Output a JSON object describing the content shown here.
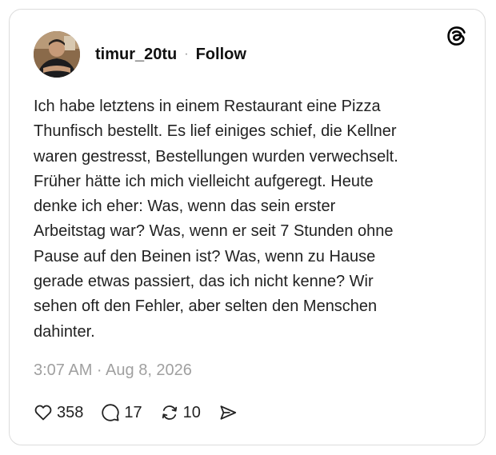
{
  "post": {
    "username": "timur_20tu",
    "separator": "·",
    "follow_label": "Follow",
    "avatar_icon": "profile-photo",
    "brand_icon": "threads-logo-icon",
    "text": "Ich habe letztens in einem Restaurant eine Pizza\nThunfisch bestellt. Es lief einiges schief, die Kellner\nwaren gestresst, Bestellungen wurden verwechselt.\nFrüher hätte ich mich vielleicht aufgeregt. Heute\ndenke ich eher: Was, wenn das sein erster\nArbeitstag war? Was, wenn er seit 7 Stunden ohne\nPause auf den Beinen ist? Was, wenn zu Hause\ngerade etwas passiert, das ich nicht kenne? Wir\nsehen oft den Fehler, aber selten den Menschen\ndahinter.",
    "timestamp": "3:07 AM · Aug 8, 2026"
  },
  "actions": {
    "likes": {
      "icon": "heart-icon",
      "count": "358"
    },
    "replies": {
      "icon": "comment-icon",
      "count": "17"
    },
    "reposts": {
      "icon": "repost-icon",
      "count": "10"
    },
    "share": {
      "icon": "send-icon"
    }
  }
}
